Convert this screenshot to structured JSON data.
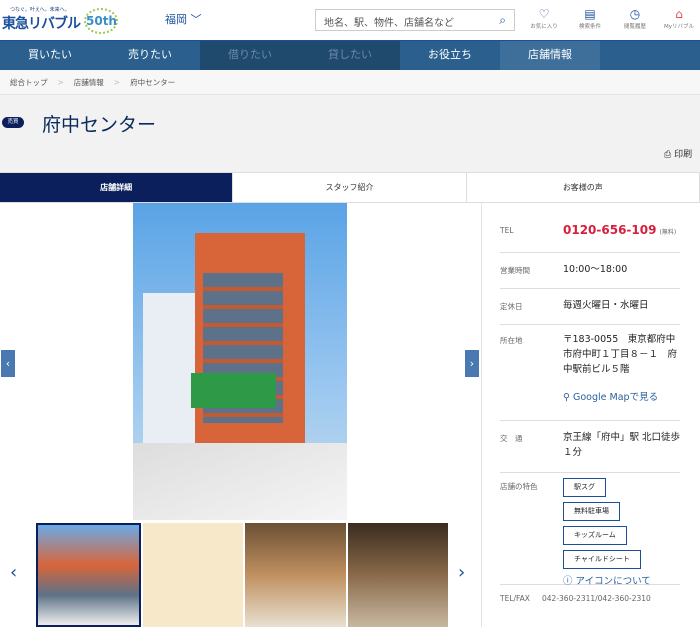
{
  "header": {
    "tagline": "つなぐ。叶えへ。未来へ。",
    "logo": "東急リバブル",
    "anniversary": "50th",
    "region": "福岡",
    "search_placeholder": "地名、駅、物件、店舗名など",
    "icons": [
      {
        "name": "favorite-icon",
        "label": "お気に入り"
      },
      {
        "name": "search-conditions-icon",
        "label": "検索条件"
      },
      {
        "name": "history-icon",
        "label": "閲覧履歴"
      },
      {
        "name": "my-livable-icon",
        "label": "Myリバブル"
      }
    ]
  },
  "nav": [
    "買いたい",
    "売りたい",
    "借りたい",
    "貸したい",
    "お役立ち",
    "店舗情報"
  ],
  "breadcrumb": [
    "総合トップ",
    "店舗情報",
    "府中センター"
  ],
  "page": {
    "badge": "売買",
    "title": "府中センター",
    "print": "印刷"
  },
  "tabs": [
    "店舗詳細",
    "スタッフ紹介",
    "お客様の声"
  ],
  "info": {
    "tel_label": "TEL",
    "tel": "0120-656-109",
    "tel_note": "(無料)",
    "hours_label": "営業時間",
    "hours": "10:00〜18:00",
    "holiday_label": "定休日",
    "holiday": "毎週火曜日・水曜日",
    "address_label": "所在地",
    "address": "〒183-0055　東京都府中市府中町１丁目８－１　府中駅前ビル５階",
    "map_link": "Google Mapで見る",
    "access_label": "交　通",
    "access": "京王線「府中」駅 北口徒歩１分",
    "features_label": "店舗の特色",
    "features": [
      "駅スグ",
      "無料駐車場",
      "キッズルーム",
      "チャイルドシート"
    ],
    "icon_help": "アイコンについて",
    "telfax_label": "TEL/FAX",
    "telfax": "042-360-2311/042-360-2310"
  },
  "colors": {
    "nav": "#2a5f8e",
    "active_tab": "#0a1f5c",
    "tel": "#d61f3c"
  }
}
